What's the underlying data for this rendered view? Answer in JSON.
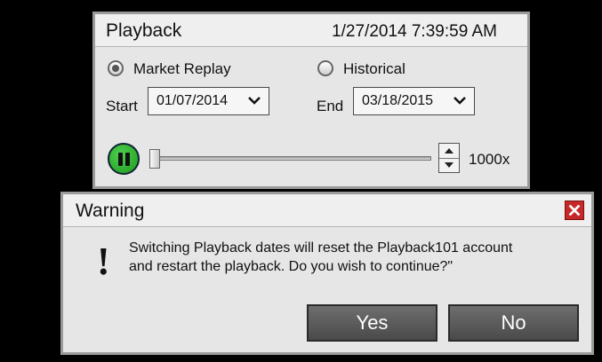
{
  "playback": {
    "title": "Playback",
    "datetime": "1/27/2014 7:39:59 AM",
    "mode_market_replay": "Market Replay",
    "mode_historical": "Historical",
    "selected_mode": "Market Replay",
    "start_label": "Start",
    "start_value": "01/07/2014",
    "end_label": "End",
    "end_value": "03/18/2015",
    "speed": "1000x",
    "slider_position_fraction": 0.0
  },
  "warning": {
    "title": "Warning",
    "icon": "exclamation-icon",
    "message_line1": "Switching Playback dates will reset the Playback101 account",
    "message_line2": "and restart the playback. Do you wish to continue?\"",
    "yes_label": "Yes",
    "no_label": "No"
  },
  "colors": {
    "play_button": "#2fb52f",
    "close_button": "#c62828",
    "dialog_button": "#5a5a5a"
  }
}
